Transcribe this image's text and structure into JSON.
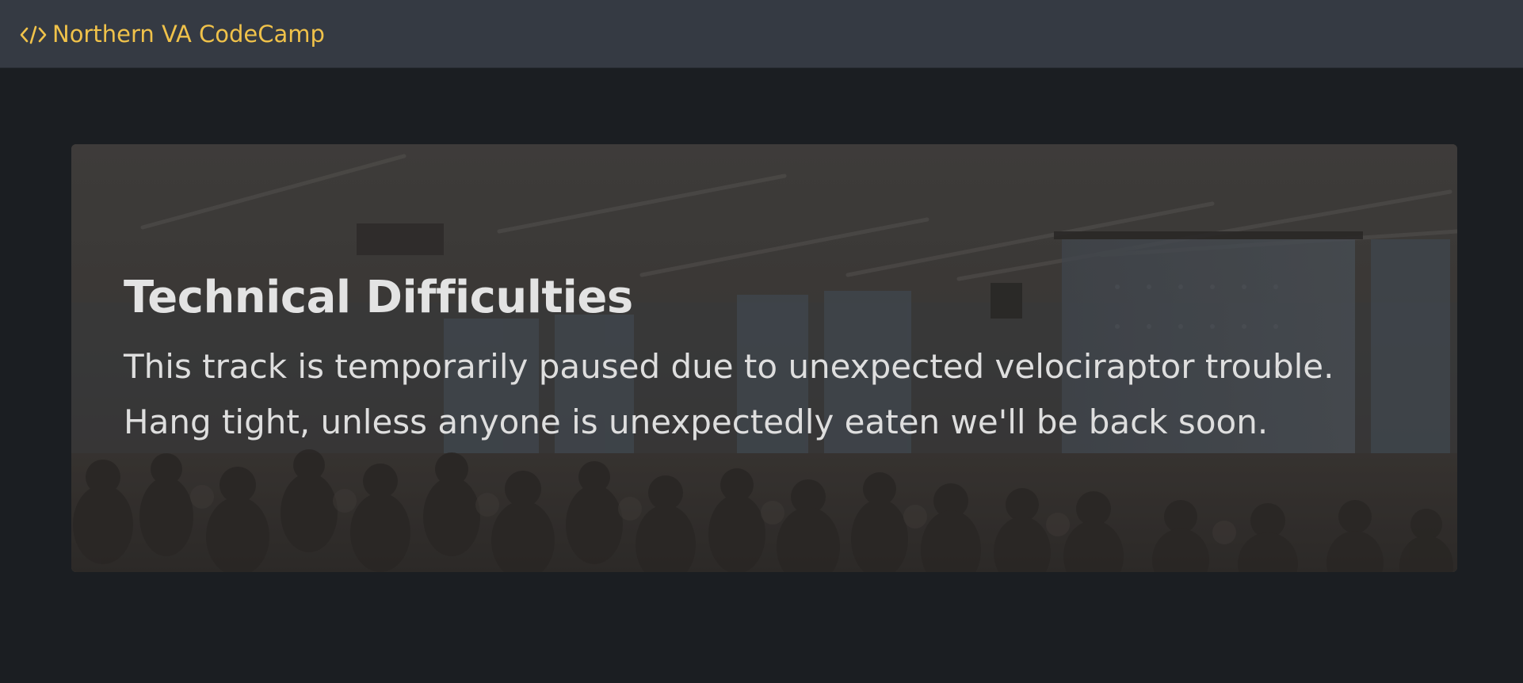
{
  "navbar": {
    "brand_icon": "code-icon",
    "brand_label": "Northern VA CodeCamp",
    "brand_color": "#f0c24a",
    "background": "#353a43"
  },
  "hero": {
    "title": "Technical Difficulties",
    "lead_line1": "This track is temporarily paused due to unexpected velociraptor trouble.",
    "lead_line2": "Hang tight, unless anyone is unexpectedly eaten we'll be back soon.",
    "background_image": "conference-room-audience-photo"
  },
  "page": {
    "background": "#1b1e22"
  }
}
